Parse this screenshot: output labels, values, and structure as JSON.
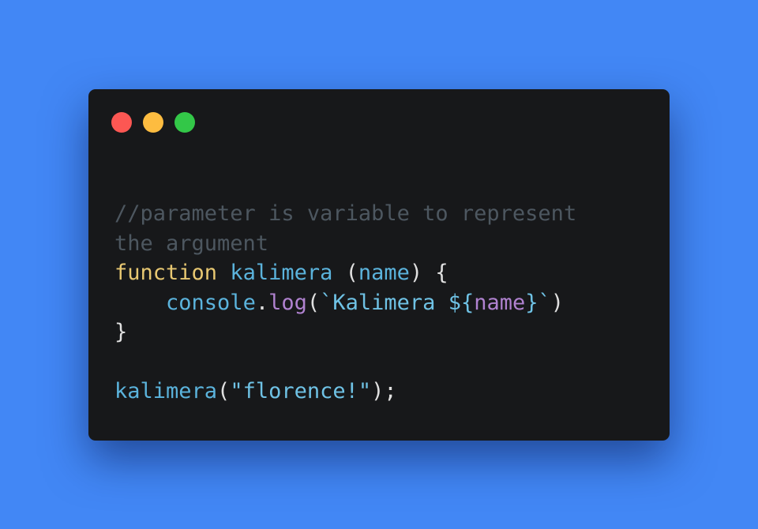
{
  "window": {
    "controls": [
      {
        "name": "close",
        "color": "#fc5753"
      },
      {
        "name": "minimize",
        "color": "#fdbc40"
      },
      {
        "name": "zoom",
        "color": "#33c748"
      }
    ]
  },
  "colors": {
    "background": "#4287f5",
    "window": "#17181a",
    "comment": "#4d5760",
    "keyword": "#e8c872",
    "identifier": "#5bb3dc",
    "method": "#b082d0",
    "string": "#6fc2e5",
    "punctuation": "#e0e0e0"
  },
  "code": {
    "comment_line1": "//parameter is variable to represent",
    "comment_line2": "the argument",
    "kw_function": "function",
    "fn_name": "kalimera",
    "paren_open": "(",
    "param": "name",
    "paren_close_brace": ") {",
    "indent": "    ",
    "console": "console",
    "dot": ".",
    "log": "log",
    "log_paren_open": "(",
    "template_start": "`Kalimera ",
    "interp_open": "${",
    "interp_name": "name",
    "interp_close": "}",
    "template_end": "`",
    "log_paren_close": ")",
    "close_brace": "}",
    "call_name": "kalimera",
    "call_paren_open": "(",
    "call_arg": "\"florence!\"",
    "call_end": ");"
  }
}
